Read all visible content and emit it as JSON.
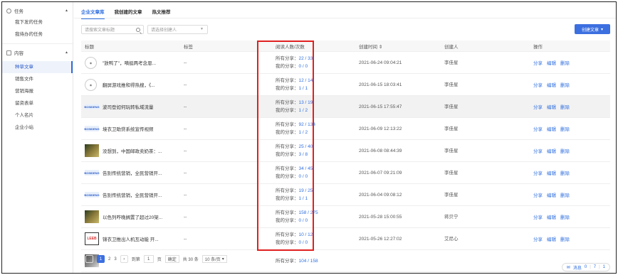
{
  "sidebar": {
    "groups": [
      {
        "label": "任务",
        "items": [
          {
            "label": "我下发的任务"
          },
          {
            "label": "我待办的任务"
          }
        ]
      },
      {
        "label": "内容",
        "items": [
          {
            "label": "种草文章"
          },
          {
            "label": "销售文件"
          },
          {
            "label": "营销海报"
          },
          {
            "label": "留资表单"
          },
          {
            "label": "个人名片"
          },
          {
            "label": "企业小站"
          }
        ]
      }
    ]
  },
  "tabs": [
    {
      "label": "企业文章库"
    },
    {
      "label": "我创建的文章"
    },
    {
      "label": "热文推荐"
    }
  ],
  "filters": {
    "search_placeholder": "请搜索文章标题",
    "creator_placeholder": "请选择创建人"
  },
  "create_button": "创建文章",
  "table": {
    "headers": {
      "title": "标题",
      "tag": "标签",
      "read": "阅读人数/次数",
      "time": "创建时间",
      "creator": "创建人",
      "ops": "操作"
    },
    "rows": [
      {
        "title": "\"放鸭了\"，嘀挺两考念恩...",
        "tag": "--",
        "all": "所有分享：",
        "all_v": "22 / 33",
        "mine": "我的分享：",
        "mine_v": "0 / 0",
        "time": "2021-06-24 09:04:21",
        "creator": "李佳星",
        "thumb": "circ"
      },
      {
        "title": "翻屏游戏推和得热搜，《...",
        "tag": "--",
        "all": "所有分享：",
        "all_v": "12 / 14",
        "mine": "我的分享：",
        "mine_v": "1 / 1",
        "time": "2021-06-15 18:03:41",
        "creator": "李佳星",
        "thumb": "circ"
      },
      {
        "title": "波司登如何玩转私域流量",
        "tag": "--",
        "all": "所有分享：",
        "all_v": "13 / 19",
        "mine": "我的分享：",
        "mine_v": "1 / 2",
        "time": "2021-06-15 17:55:47",
        "creator": "李佳星",
        "thumb": "banner"
      },
      {
        "title": "境衣卫助贷系统宣传视频",
        "tag": "--",
        "all": "所有分享：",
        "all_v": "92 / 134",
        "mine": "我的分享：",
        "mine_v": "1 / 2",
        "time": "2021-06-09 12:13:22",
        "creator": "李佳星",
        "thumb": "banner"
      },
      {
        "title": "没想到，中国邮政卖奶茶：...",
        "tag": "--",
        "all": "所有分享：",
        "all_v": "25 / 40",
        "mine": "我的分享：",
        "mine_v": "3 / 8",
        "time": "2021-06-08 08:44:39",
        "creator": "李佳星",
        "thumb": "photo"
      },
      {
        "title": "告别传统营销，全民营销开...",
        "tag": "--",
        "all": "所有分享：",
        "all_v": "34 / 45",
        "mine": "我的分享：",
        "mine_v": "0 / 0",
        "time": "2021-06-07 09:21:09",
        "creator": "李佳星",
        "thumb": "banner"
      },
      {
        "title": "告别传统营销，全民营销开...",
        "tag": "--",
        "all": "所有分享：",
        "all_v": "19 / 25",
        "mine": "我的分享：",
        "mine_v": "1 / 1",
        "time": "2021-06-04 09:08:12",
        "creator": "李佳星",
        "thumb": "banner"
      },
      {
        "title": "以色列咋晚搁置了超过20架...",
        "tag": "--",
        "all": "所有分享：",
        "all_v": "158 / 275",
        "mine": "我的分享：",
        "mine_v": "0 / 0",
        "time": "2021-05-28 15:00:55",
        "creator": "蒋贝宁",
        "thumb": "photo"
      },
      {
        "title": "锦衣卫推出人机互动能 开...",
        "tag": "--",
        "all": "所有分享：",
        "all_v": "10 / 12",
        "mine": "我的分享：",
        "mine_v": "0 / 0",
        "time": "2021-05-26 12:27:02",
        "creator": "艾尼心",
        "thumb": "logo"
      },
      {
        "title": "",
        "tag": "",
        "all": "所有分享：",
        "all_v": "104 / 158",
        "mine": "",
        "mine_v": "",
        "time": "",
        "creator": "",
        "thumb": "photo2"
      }
    ],
    "ops": {
      "share": "分享",
      "edit": "编辑",
      "delete": "删除"
    }
  },
  "pager": {
    "pages": [
      "1",
      "2",
      "3"
    ],
    "goto_label": "到第",
    "page_input": "1",
    "page_unit": "页",
    "confirm": "确定",
    "total": "共 30 条",
    "size": "10 条/页"
  },
  "msg": {
    "label": "消息",
    "a": "0",
    "b": "7",
    "c": "1"
  },
  "colors": {
    "accent": "#3c6fe0",
    "highlight_box": "#e02020"
  }
}
